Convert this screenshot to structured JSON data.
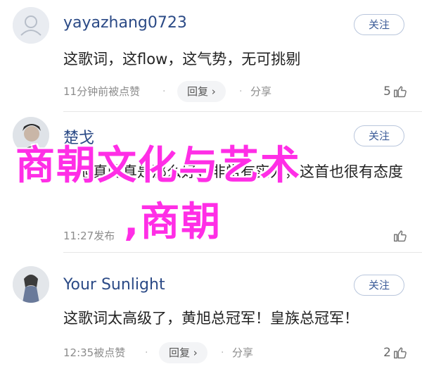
{
  "comments": [
    {
      "username": "yayazhang0723",
      "follow_label": "关注",
      "text": "这歌词，这flow，这气势，无可挑剔",
      "time": "11分钟前被点赞",
      "reply_label": "回复",
      "share_label": "分享",
      "like_count": "5",
      "avatar_icon": "default-avatar-icon"
    },
    {
      "username": "楚戈",
      "follow_label": "关注",
      "text": "黄旭真的真是那么好，非常有实力，这首也很有态度",
      "time": "11:27发布",
      "reply_label": "",
      "share_label": "",
      "like_count": "",
      "avatar_icon": "portrait-avatar-icon"
    },
    {
      "username": "Your Sunlight",
      "follow_label": "关注",
      "text": "这歌词太高级了，黄旭总冠军！皇族总冠军！",
      "time": "12:35被点赞",
      "reply_label": "回复",
      "share_label": "分享",
      "like_count": "2",
      "avatar_icon": "portrait-avatar-icon"
    }
  ],
  "watermark": {
    "line1": "商朝文化与艺术",
    "line2": ",商朝",
    "color": "#ff2ee6"
  },
  "colors": {
    "username": "#2b4a86",
    "follow_border": "#b9c6dc",
    "meta": "#8c8c8c"
  }
}
